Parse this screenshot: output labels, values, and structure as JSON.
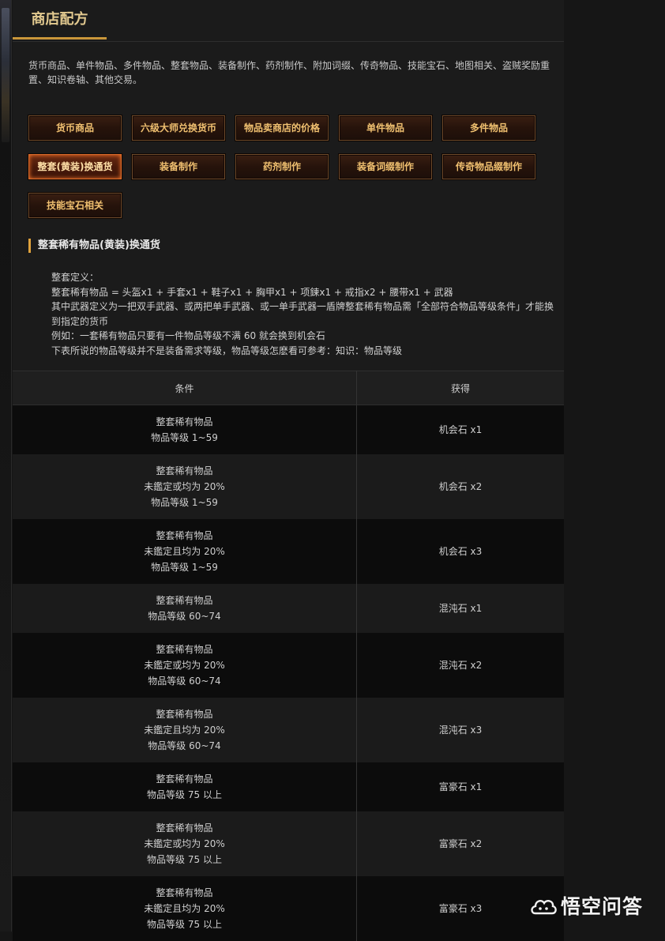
{
  "section": {
    "title": "商店配方"
  },
  "intro": "货币商品、单件物品、多件物品、整套物品、装备制作、药剂制作、附加词缀、传奇物品、技能宝石、地图相关、盗贼奖励重置、知识卷轴、其他交易。",
  "buttons": [
    {
      "label": "货币商品",
      "active": false
    },
    {
      "label": "六级大师兑换货币",
      "active": false
    },
    {
      "label": "物品卖商店的价格",
      "active": false
    },
    {
      "label": "单件物品",
      "active": false
    },
    {
      "label": "多件物品",
      "active": false
    },
    {
      "label": "整套(黄装)换通货",
      "active": true
    },
    {
      "label": "装备制作",
      "active": false
    },
    {
      "label": "药剂制作",
      "active": false
    },
    {
      "label": "装备词缀制作",
      "active": false
    },
    {
      "label": "传奇物品缀制作",
      "active": false
    },
    {
      "label": "技能宝石相关",
      "active": false
    }
  ],
  "subheader": "整套稀有物品(黄装)换通货",
  "definition": [
    "整套定义：",
    "整套稀有物品 = 头盔x1 + 手套x1 + 鞋子x1 + 胸甲x1 + 项鍊x1 + 戒指x2 + 腰带x1 + 武器",
    "其中武器定义为一把双手武器、或两把单手武器、或一单手武器一盾牌整套稀有物品需「全部符合物品等级条件」才能换到指定的货币",
    "例如：一套稀有物品只要有一件物品等级不满 60 就会换到机会石",
    "下表所说的物品等级并不是装备需求等级，物品等级怎麽看可参考：知识：物品等级"
  ],
  "table": {
    "headers": {
      "condition": "条件",
      "reward": "获得"
    },
    "rows": [
      {
        "condition": [
          "整套稀有物品",
          "物品等级 1~59"
        ],
        "reward": "机会石 x1"
      },
      {
        "condition": [
          "整套稀有物品",
          "未鑑定或均为 20%",
          "物品等级 1~59"
        ],
        "reward": "机会石 x2"
      },
      {
        "condition": [
          "整套稀有物品",
          "未鑑定且均为 20%",
          "物品等级 1~59"
        ],
        "reward": "机会石 x3"
      },
      {
        "condition": [
          "整套稀有物品",
          "物品等级 60~74"
        ],
        "reward": "混沌石 x1"
      },
      {
        "condition": [
          "整套稀有物品",
          "未鑑定或均为 20%",
          "物品等级 60~74"
        ],
        "reward": "混沌石 x2"
      },
      {
        "condition": [
          "整套稀有物品",
          "未鑑定且均为 20%",
          "物品等级 60~74"
        ],
        "reward": "混沌石 x3"
      },
      {
        "condition": [
          "整套稀有物品",
          "物品等级 75 以上"
        ],
        "reward": "富豪石 x1"
      },
      {
        "condition": [
          "整套稀有物品",
          "未鑑定或均为 20%",
          "物品等级 75 以上"
        ],
        "reward": "富豪石 x2"
      },
      {
        "condition": [
          "整套稀有物品",
          "未鑑定且均为 20%",
          "物品等级 75 以上"
        ],
        "reward": "富豪石 x3"
      }
    ]
  },
  "watermark": {
    "text": "悟空问答",
    "icon": "cloud-logo-icon"
  },
  "colors": {
    "accent": "#c9963a",
    "button_text": "#f0c070",
    "active_border": "#d96a2a"
  }
}
